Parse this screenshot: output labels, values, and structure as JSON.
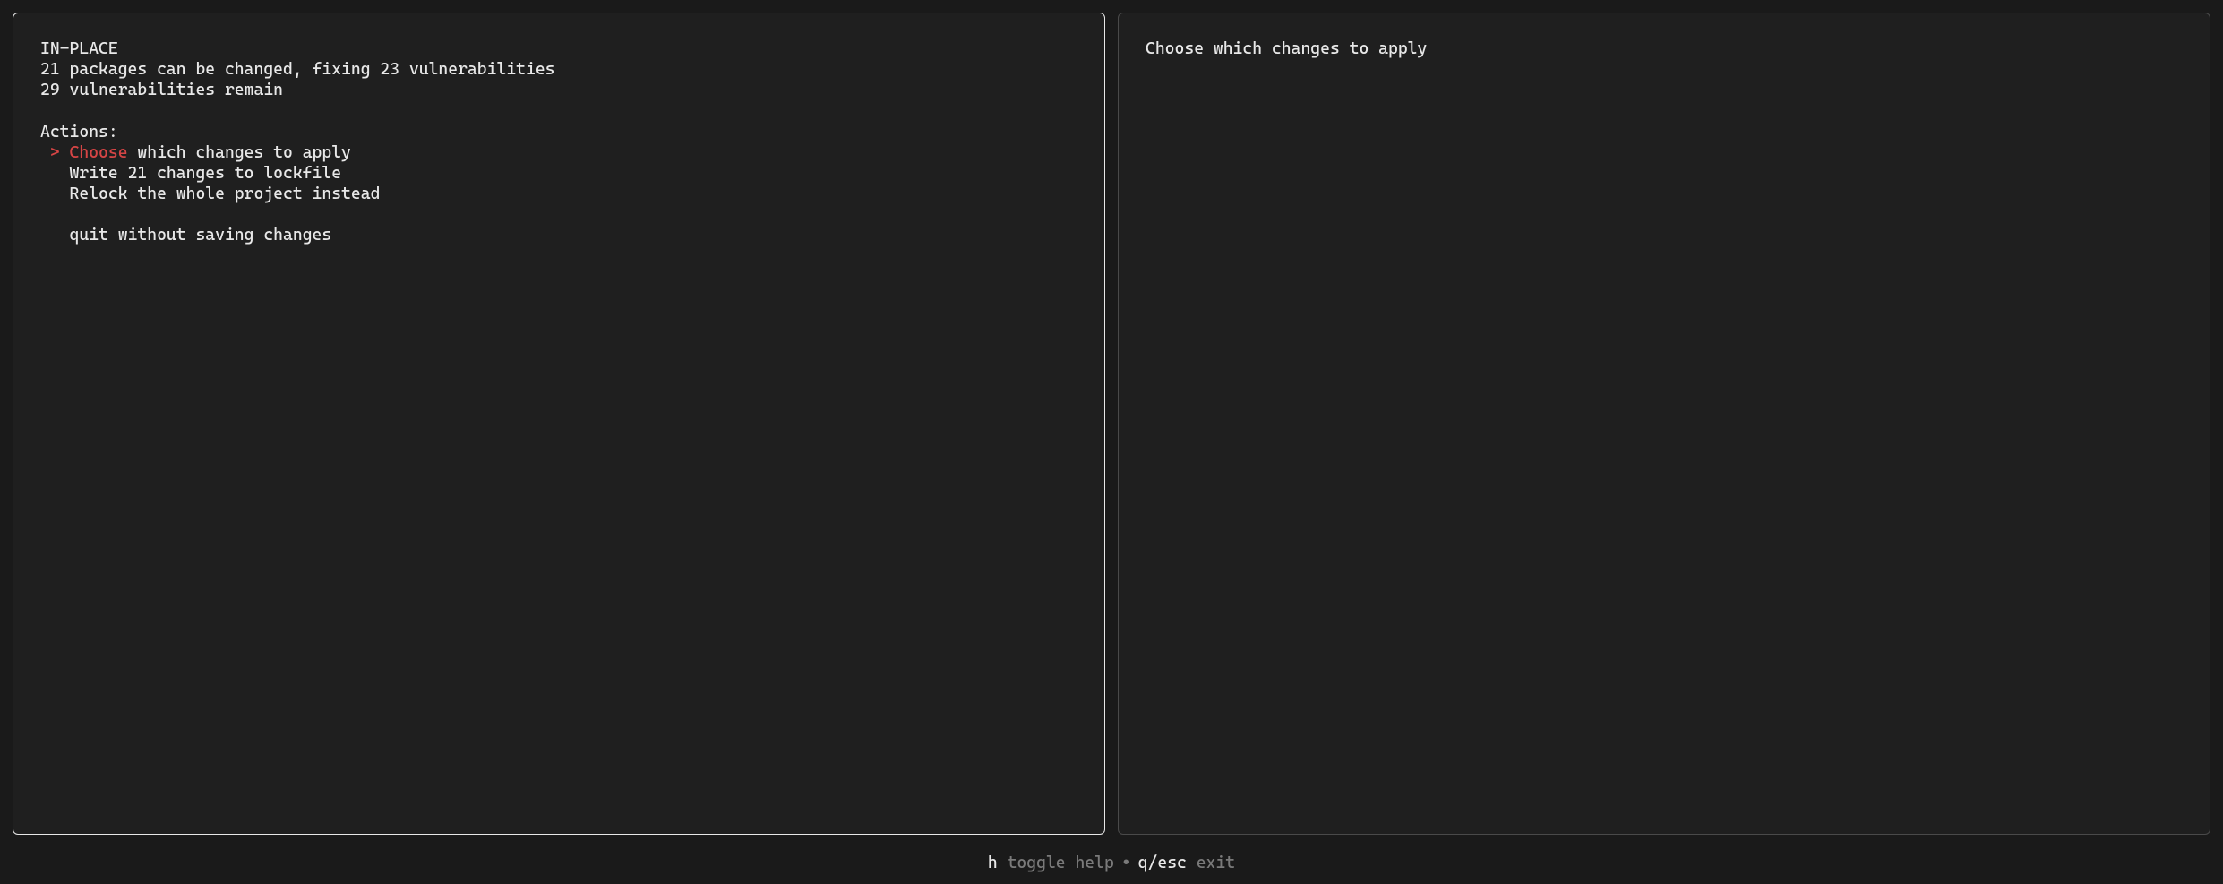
{
  "left": {
    "header": "IN-PLACE",
    "summary1": "21 packages can be changed, fixing 23 vulnerabilities",
    "summary2": "29 vulnerabilities remain",
    "actions_label": "Actions:",
    "selector": " > ",
    "indent": "   ",
    "action_selected_hl": "Choose",
    "action_selected_rest": " which changes to apply",
    "action_write": "Write 21 changes to lockfile",
    "action_relock": "Relock the whole project instead",
    "action_quit": "quit without saving changes"
  },
  "right": {
    "title": "Choose which changes to apply"
  },
  "footer": {
    "help_key": "h",
    "help_label": " toggle help",
    "sep": "•",
    "exit_key": "q/esc",
    "exit_label": " exit"
  }
}
